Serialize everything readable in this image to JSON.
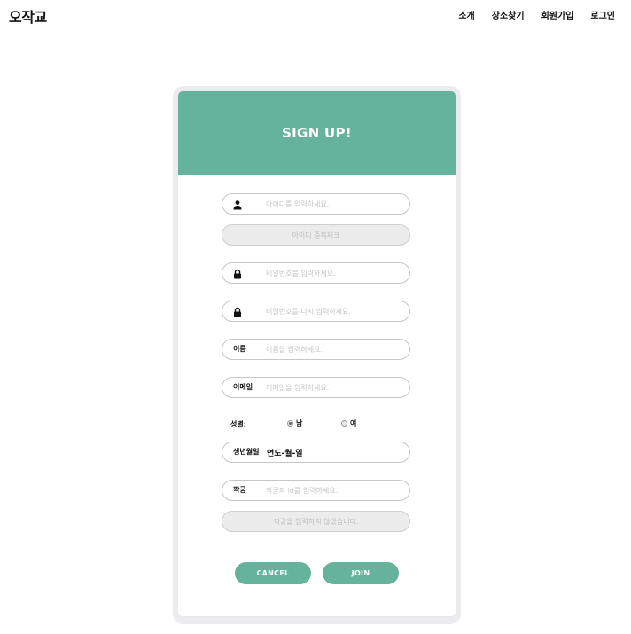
{
  "app": {
    "logo": "오작교"
  },
  "nav": {
    "items": [
      "소개",
      "장소찾기",
      "회원가입",
      "로그인"
    ]
  },
  "form": {
    "title": "SIGN UP!",
    "id_placeholder": "아이디를 입력하세요.",
    "id_check_label": "아이디 중복체크",
    "password_placeholder": "비밀번호를 입력하세요.",
    "password_confirm_placeholder": "비밀번호를 다시 입력하세요.",
    "name_label": "이름",
    "name_placeholder": "이름을 입력하세요.",
    "email_label": "이메일",
    "email_placeholder": "이메일을 입력하세요.",
    "gender_label": "성별:",
    "gender_male": "남",
    "gender_female": "여",
    "gender_selected": "남",
    "birth_label": "생년월일",
    "birth_value": "연도-월-일",
    "partner_label": "짝궁",
    "partner_placeholder": "짝궁의 id를 입력하세요.",
    "partner_status": "짝궁을 입력하지 않았습니다.",
    "cancel_label": "CANCEL",
    "join_label": "JOIN"
  },
  "colors": {
    "accent": "#65b39a",
    "card_border": "#ececef",
    "field_border": "#c7c7c7"
  },
  "icons": {
    "user": "person-icon",
    "password": "lock-icon",
    "password_confirm": "lock-icon"
  }
}
